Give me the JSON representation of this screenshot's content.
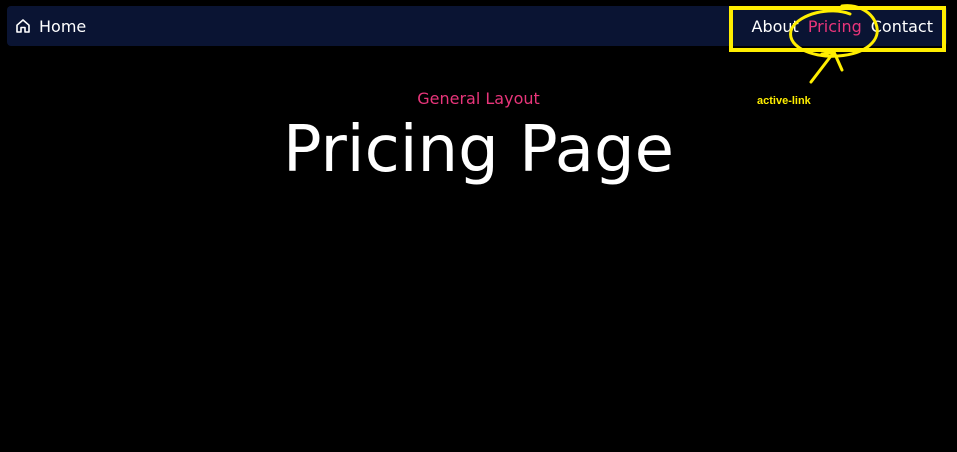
{
  "nav": {
    "home_label": "Home",
    "home_icon": "home-icon",
    "links": [
      {
        "label": "About",
        "active": false
      },
      {
        "label": "Pricing",
        "active": true
      },
      {
        "label": "Contact",
        "active": false
      }
    ]
  },
  "main": {
    "subtitle": "General Layout",
    "title": "Pricing Page"
  },
  "annotation": {
    "label": "active-link",
    "color": "#ffee00"
  },
  "colors": {
    "background": "#000000",
    "navbar": "#0a1433",
    "accent": "#e8357a",
    "text": "#ffffff"
  }
}
